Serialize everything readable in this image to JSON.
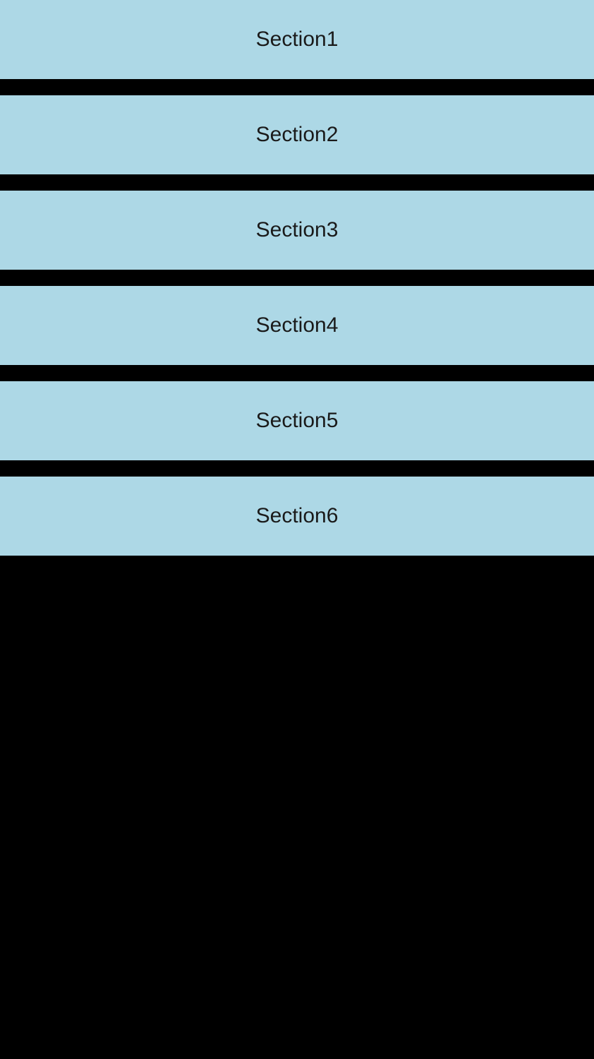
{
  "colors": {
    "section_background": "#add8e6",
    "page_background": "#000000",
    "text": "#1a1a1a"
  },
  "sections": [
    {
      "label": "Section1"
    },
    {
      "label": "Section2"
    },
    {
      "label": "Section3"
    },
    {
      "label": "Section4"
    },
    {
      "label": "Section5"
    },
    {
      "label": "Section6"
    }
  ]
}
